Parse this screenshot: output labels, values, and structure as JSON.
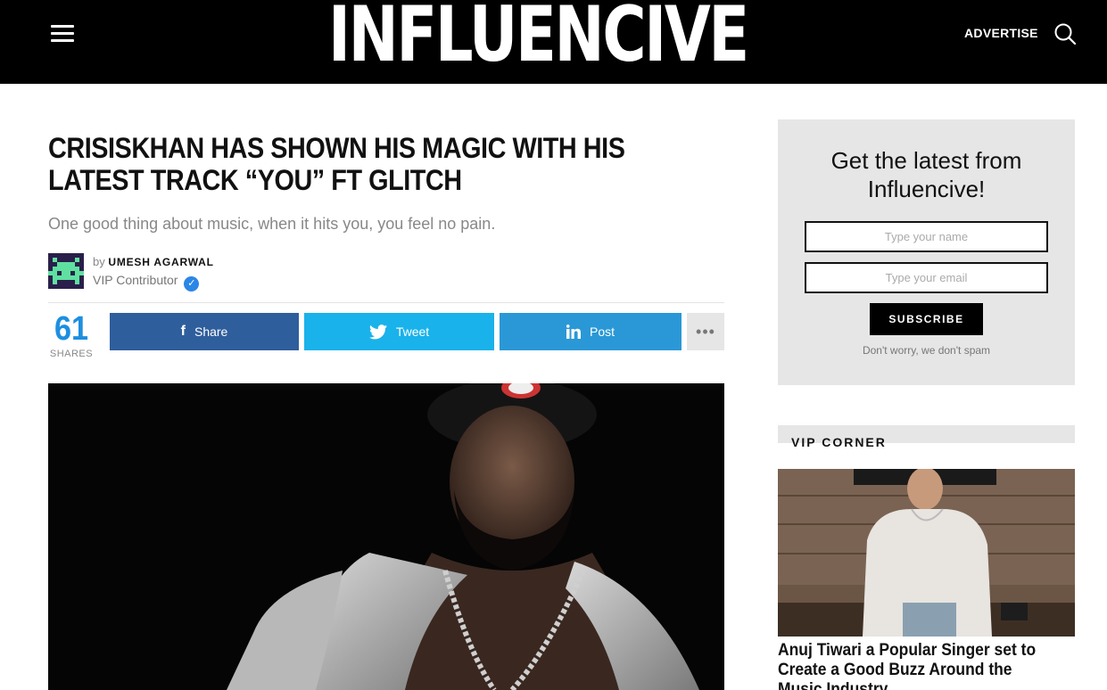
{
  "header": {
    "logo": "INFLUENCIVE",
    "advertise": "ADVERTISE",
    "menu_icon": "hamburger-icon",
    "search_icon": "search-icon"
  },
  "article": {
    "title": "CRISISKHAN HAS SHOWN HIS MAGIC WITH HIS LATEST TRACK “YOU” FT GLITCH",
    "subtitle": "One good thing about music, when it hits you, you feel no pain.",
    "author": {
      "by": "by",
      "name": "UMESH AGARWAL",
      "role": "VIP Contributor",
      "verified_icon": "verified-check-icon"
    },
    "shares": {
      "count": "61",
      "label": "SHARES"
    },
    "share_buttons": {
      "facebook": "Share",
      "twitter": "Tweet",
      "linkedin": "Post",
      "more_icon": "more-dots-icon"
    }
  },
  "sidebar": {
    "newsletter": {
      "title": "Get the latest from Influencive!",
      "name_placeholder": "Type your name",
      "email_placeholder": "Type your email",
      "subscribe": "SUBSCRIBE",
      "note": "Don't worry, we don't spam"
    },
    "vip_corner": {
      "label": "VIP CORNER",
      "headline": "Anuj Tiwari a Popular Singer set to Create a Good Buzz Around the Music Industry"
    }
  },
  "colors": {
    "facebook": "#2f5e9c",
    "twitter": "#1ab2ea",
    "linkedin": "#2a98d6",
    "share_count": "#1d8fe0"
  }
}
